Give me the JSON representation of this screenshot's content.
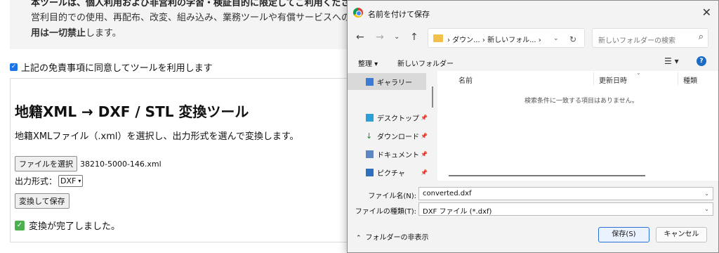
{
  "notice": {
    "line1": "本ツールは、個人利用および非営利の学習・検証目的に限定してご利用ください。",
    "line2": "営利目的での使用、再配布、改変、組み込み、業務ツールや有償サービスへの利用",
    "line3_bold": "用は一切禁止",
    "line3_rest": "します。"
  },
  "agree": {
    "label": "上記の免責事項に同意してツールを利用します",
    "checked": true
  },
  "tool": {
    "title": "地籍XML → DXF / STL 変換ツール",
    "description": "地籍XMLファイル（.xml）を選択し、出力形式を選んで変換します。",
    "file_button": "ファイルを選択",
    "file_name": "38210-5000-146.xml",
    "format_label": "出力形式：",
    "format_value": "DXF",
    "convert_button": "変換して保存",
    "status": "変換が完了しました。"
  },
  "dialog": {
    "title": "名前を付けて保存",
    "close": "✕",
    "address": "›  ダウン...  ›  新しいフォル...  ›",
    "search_placeholder": "新しいフォルダーの検索",
    "organize": "整理 ▾",
    "new_folder": "新しいフォルダー",
    "nav_items": [
      {
        "label": "ギャラリー",
        "icon": "gallery-icon",
        "selected": true
      },
      {
        "label": "デスクトップ",
        "icon": "desktop-icon",
        "pinned": true
      },
      {
        "label": "ダウンロード",
        "icon": "download-icon",
        "pinned": true
      },
      {
        "label": "ドキュメント",
        "icon": "documents-icon",
        "pinned": true
      },
      {
        "label": "ピクチャ",
        "icon": "pictures-icon",
        "pinned": true
      }
    ],
    "columns": [
      "名前",
      "更新日時",
      "種類"
    ],
    "empty_message": "検索条件に一致する項目はありません。",
    "filename_label": "ファイル名(N):",
    "filename_value": "converted.dxf",
    "filetype_label": "ファイルの種類(T):",
    "filetype_value": "DXF ファイル (*.dxf)",
    "hide_folders": "フォルダーの非表示",
    "save_button": "保存(S)",
    "cancel_button": "キャンセル"
  },
  "colors": {
    "accent": "#1a73e8",
    "success": "#4caf50",
    "folder": "#f3c04b",
    "primary_button_border": "#2a6fd6"
  }
}
